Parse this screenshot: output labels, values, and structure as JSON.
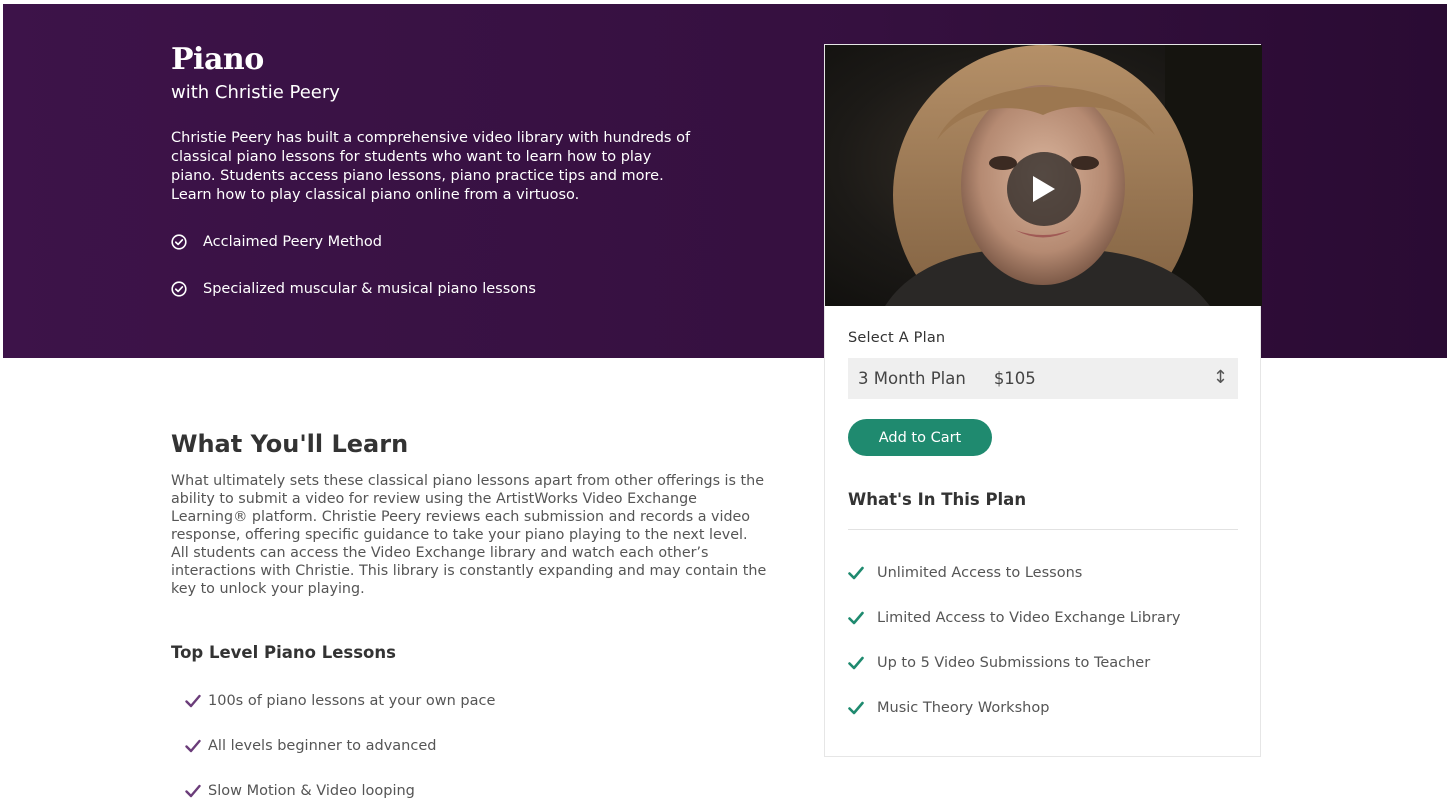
{
  "hero": {
    "title": "Piano",
    "subtitle": "with Christie Peery",
    "description": "Christie Peery has built a comprehensive video library with hundreds of classical piano lessons for students who want to learn how to play piano. Students access piano lessons, piano practice tips and more. Learn how to play classical piano online from a virtuoso.",
    "features": [
      "Acclaimed Peery Method",
      "Specialized muscular & musical piano lessons"
    ]
  },
  "plan": {
    "select_label": "Select A Plan",
    "selected_name": "3 Month Plan",
    "selected_price": "$105",
    "add_to_cart": "Add to Cart",
    "heading": "What's In This Plan",
    "items": [
      "Unlimited Access to Lessons",
      "Limited Access to Video Exchange Library",
      "Up to 5 Video Submissions to Teacher",
      "Music Theory Workshop"
    ]
  },
  "learn": {
    "title": "What You'll Learn",
    "description": "What ultimately sets these classical piano lessons apart from other offerings is the ability to submit a video for review using the ArtistWorks Video Exchange Learning® platform. Christie Peery reviews each submission and records a video response, offering specific guidance to take your piano playing to the next level. All students can access the Video Exchange library and watch each other’s interactions with Christie. This library is constantly expanding and may contain the key to unlock your playing.",
    "lessons_title": "Top Level Piano Lessons",
    "lessons": [
      "100s of piano lessons at your own pace",
      "All levels beginner to advanced",
      "Slow Motion & Video looping"
    ]
  },
  "colors": {
    "hero_bg": "#3d1349",
    "accent_green": "#1f8a6f",
    "lesson_check": "#6b3d7a"
  }
}
